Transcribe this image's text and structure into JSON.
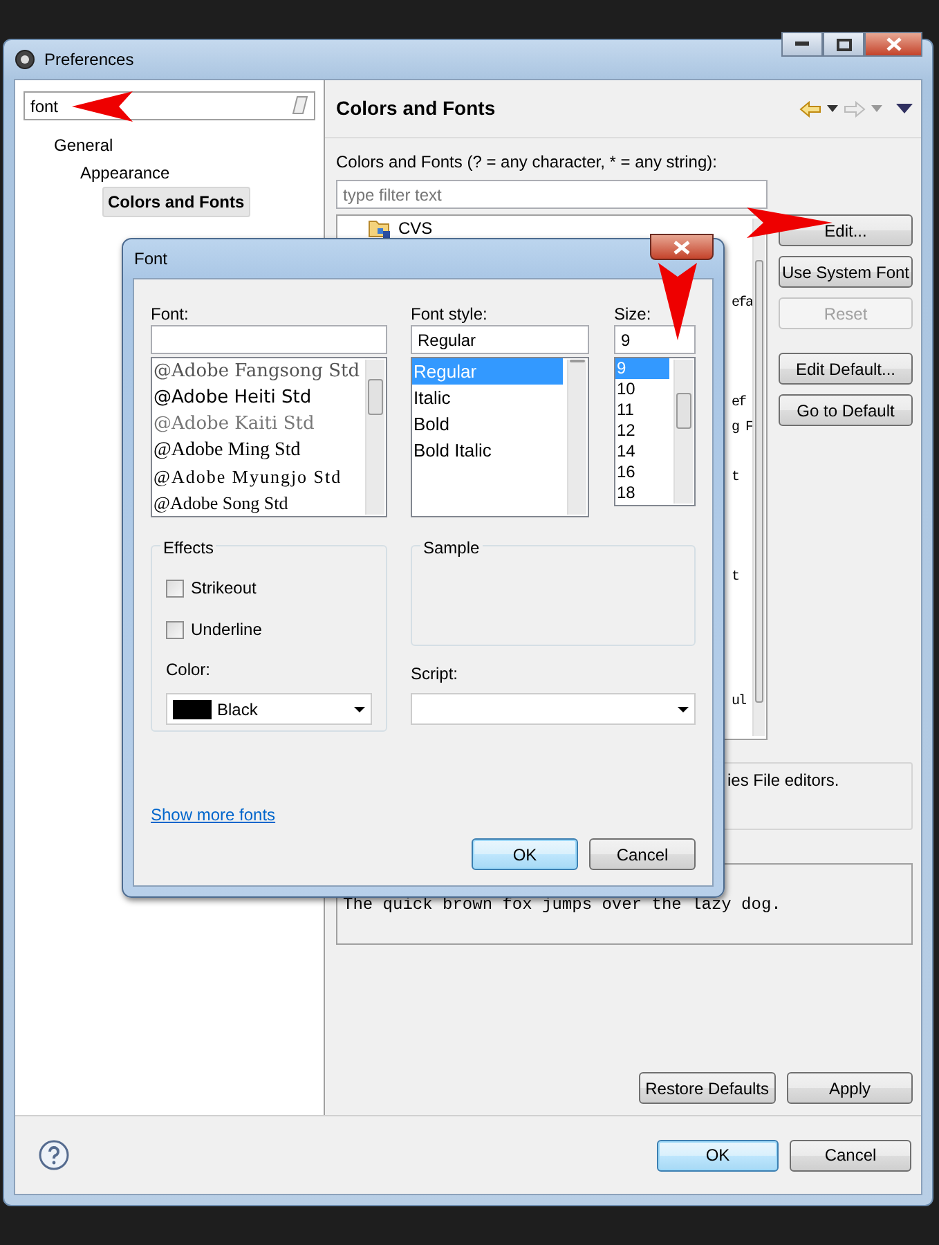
{
  "window": {
    "title": "Preferences"
  },
  "sidebar": {
    "search": {
      "value": "font"
    },
    "tree": [
      {
        "label": "General",
        "selected": false,
        "children": [
          {
            "label": "Appearance",
            "selected": false,
            "children": [
              {
                "label": "Colors and Fonts",
                "selected": true
              }
            ]
          }
        ]
      }
    ]
  },
  "page": {
    "title": "Colors and Fonts",
    "filter_label": "Colors and Fonts (? = any character, * = any string):",
    "filter": {
      "placeholder": "type filter text"
    },
    "tree": [
      {
        "label": "CVS"
      }
    ],
    "tree_fragments": [
      "efa",
      "ef",
      "g F",
      "t",
      "t",
      "ul"
    ],
    "side_buttons": [
      {
        "label": "Edit...",
        "disabled": false
      },
      {
        "label": "Use System Font",
        "disabled": false
      },
      {
        "label": "Reset",
        "disabled": true
      },
      {
        "label": "Edit Default...",
        "disabled": false
      },
      {
        "label": "Go to Default",
        "disabled": false
      }
    ],
    "description": "ies File editors.",
    "preview": "The quick brown fox jumps over the lazy dog.",
    "buttons": [
      {
        "label": "Restore Defaults"
      },
      {
        "label": "Apply"
      }
    ]
  },
  "footer": {
    "buttons": [
      {
        "label": "OK",
        "default": true
      },
      {
        "label": "Cancel",
        "default": false
      }
    ]
  },
  "font_dialog": {
    "title": "Font",
    "font": {
      "label": "Font:",
      "items": [
        {
          "label": "@Adobe Fangsong Std",
          "selected": false
        },
        {
          "label": "@Adobe Heiti Std",
          "selected": false
        },
        {
          "label": "@Adobe Kaiti Std",
          "selected": false
        },
        {
          "label": "@Adobe Ming Std",
          "selected": false
        },
        {
          "label": "@Adobe Myungjo Std",
          "selected": false
        },
        {
          "label": "@Adobe Song Std",
          "selected": false
        }
      ]
    },
    "style": {
      "label": "Font style:",
      "value": "Regular",
      "items": [
        {
          "label": "Regular",
          "selected": true
        },
        {
          "label": "Italic",
          "selected": false
        },
        {
          "label": "Bold",
          "selected": false
        },
        {
          "label": "Bold Italic",
          "selected": false
        }
      ]
    },
    "size": {
      "label": "Size:",
      "value": "9",
      "items": [
        {
          "label": "9",
          "selected": true
        },
        {
          "label": "10",
          "selected": false
        },
        {
          "label": "11",
          "selected": false
        },
        {
          "label": "12",
          "selected": false
        },
        {
          "label": "14",
          "selected": false
        },
        {
          "label": "16",
          "selected": false
        },
        {
          "label": "18",
          "selected": false
        }
      ]
    },
    "effects": {
      "title": "Effects",
      "options": [
        {
          "label": "Strikeout",
          "checked": false
        },
        {
          "label": "Underline",
          "checked": false
        }
      ],
      "color_label": "Color:",
      "color": {
        "value": "Black",
        "color": "#000000"
      }
    },
    "sample": {
      "title": "Sample"
    },
    "script_label": "Script:",
    "link": "Show more fonts",
    "buttons": [
      {
        "label": "OK",
        "default": true
      },
      {
        "label": "Cancel",
        "default": false
      }
    ]
  }
}
